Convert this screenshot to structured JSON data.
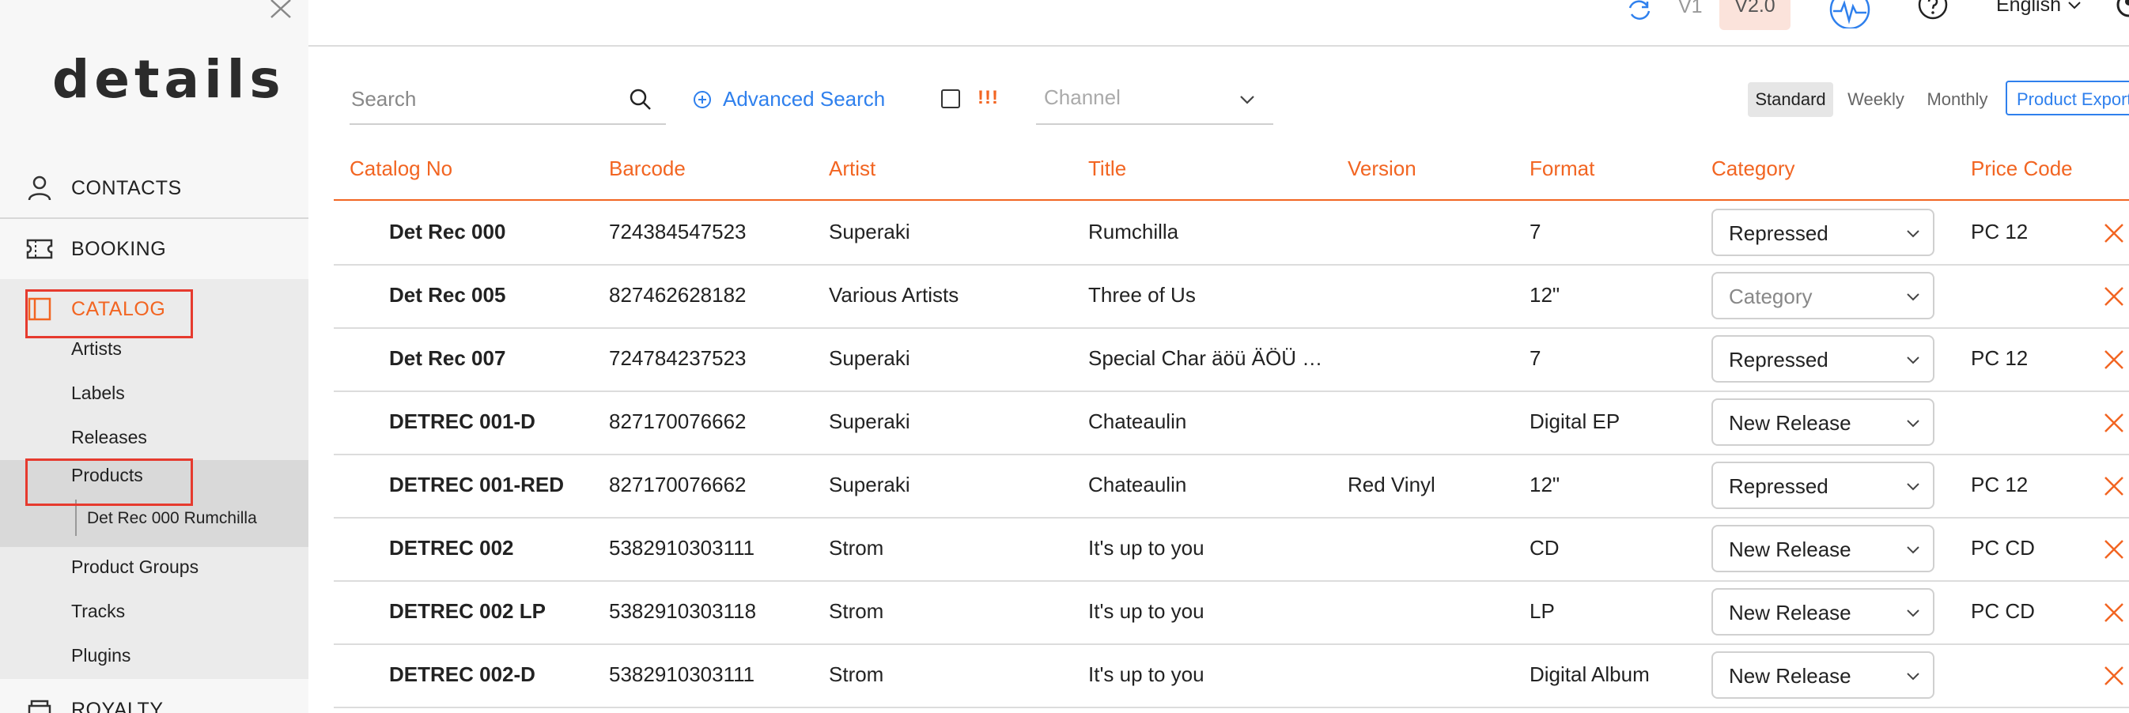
{
  "sidebar": {
    "logo": "details",
    "nav": {
      "contacts": "CONTACTS",
      "booking": "BOOKING",
      "catalog": "CATALOG",
      "royalty": "ROYALTY"
    },
    "catalog_sub": {
      "artists": "Artists",
      "labels": "Labels",
      "releases": "Releases",
      "products": "Products",
      "product_item": "Det Rec 000 Rumchilla",
      "product_groups": "Product Groups",
      "tracks": "Tracks",
      "plugins": "Plugins"
    }
  },
  "topbar": {
    "v1": "V1",
    "v2": "V2.0",
    "language": "English"
  },
  "toolbar": {
    "search_placeholder": "Search",
    "advanced_search": "Advanced Search",
    "flag_label": "!!!",
    "channel_placeholder": "Channel",
    "segments": {
      "standard": "Standard",
      "weekly": "Weekly",
      "monthly": "Monthly"
    },
    "export_label": "Product Export"
  },
  "table": {
    "headers": {
      "catalog_no": "Catalog No",
      "barcode": "Barcode",
      "artist": "Artist",
      "title": "Title",
      "version": "Version",
      "format": "Format",
      "category": "Category",
      "price_code": "Price Code"
    },
    "category_placeholder": "Category",
    "rows": [
      {
        "catalog_no": "Det Rec 000",
        "barcode": "724384547523",
        "artist": "Superaki",
        "title": "Rumchilla",
        "version": "",
        "format": "7",
        "category": "Repressed",
        "price_code": "PC 12"
      },
      {
        "catalog_no": "Det Rec 005",
        "barcode": "827462628182",
        "artist": "Various Artists",
        "title": "Three of Us",
        "version": "",
        "format": "12\"",
        "category": "",
        "price_code": ""
      },
      {
        "catalog_no": "Det Rec 007",
        "barcode": "724784237523",
        "artist": "Superaki",
        "title": "Special Char äöü ÄÖÜ …",
        "version": "",
        "format": "7",
        "category": "Repressed",
        "price_code": "PC 12"
      },
      {
        "catalog_no": "DETREC 001-D",
        "barcode": "827170076662",
        "artist": "Superaki",
        "title": "Chateaulin",
        "version": "",
        "format": "Digital EP",
        "category": "New Release",
        "price_code": ""
      },
      {
        "catalog_no": "DETREC 001-RED",
        "barcode": "827170076662",
        "artist": "Superaki",
        "title": "Chateaulin",
        "version": "Red Vinyl",
        "format": "12\"",
        "category": "Repressed",
        "price_code": "PC 12"
      },
      {
        "catalog_no": "DETREC 002",
        "barcode": "5382910303111",
        "artist": "Strom",
        "title": "It's up to you",
        "version": "",
        "format": "CD",
        "category": "New Release",
        "price_code": "PC CD"
      },
      {
        "catalog_no": "DETREC 002 LP",
        "barcode": "5382910303118",
        "artist": "Strom",
        "title": "It's up to you",
        "version": "",
        "format": "LP",
        "category": "New Release",
        "price_code": "PC CD"
      },
      {
        "catalog_no": "DETREC 002-D",
        "barcode": "5382910303111",
        "artist": "Strom",
        "title": "It's up to you",
        "version": "",
        "format": "Digital Album",
        "category": "New Release",
        "price_code": ""
      }
    ]
  },
  "colors": {
    "accent": "#f26522",
    "link": "#2f80ed",
    "highlight": "#e63a2e"
  }
}
